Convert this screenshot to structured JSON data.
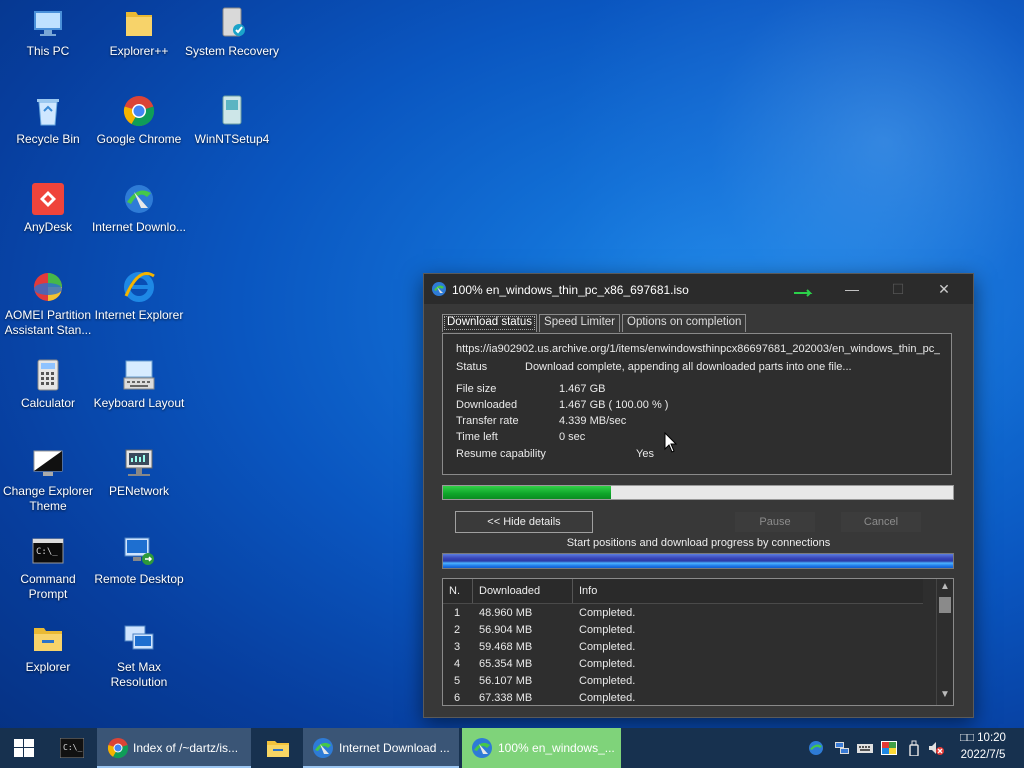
{
  "desktop": {
    "icons": [
      {
        "label": "This PC",
        "name": "this-pc-icon"
      },
      {
        "label": "Explorer++",
        "name": "explorer-plus-plus-icon"
      },
      {
        "label": "System Recovery",
        "name": "system-recovery-icon"
      },
      {
        "label": "Recycle Bin",
        "name": "recycle-bin-icon"
      },
      {
        "label": "Google Chrome",
        "name": "google-chrome-icon"
      },
      {
        "label": "WinNTSetup4",
        "name": "winntsetup-icon"
      },
      {
        "label": "AnyDesk",
        "name": "anydesk-icon"
      },
      {
        "label": "Internet Downlo...",
        "name": "internet-download-manager-icon"
      },
      {
        "label": "AOMEI Partition Assistant Stan...",
        "name": "aomei-partition-icon"
      },
      {
        "label": "Internet Explorer",
        "name": "internet-explorer-icon"
      },
      {
        "label": "Calculator",
        "name": "calculator-icon"
      },
      {
        "label": "Keyboard Layout",
        "name": "keyboard-layout-icon"
      },
      {
        "label": "Change Explorer Theme",
        "name": "change-explorer-theme-icon"
      },
      {
        "label": "PENetwork",
        "name": "penetwork-icon"
      },
      {
        "label": "Command Prompt",
        "name": "command-prompt-icon"
      },
      {
        "label": "Remote Desktop",
        "name": "remote-desktop-icon"
      },
      {
        "label": "Explorer",
        "name": "explorer-icon"
      },
      {
        "label": "Set Max Resolution",
        "name": "set-max-resolution-icon"
      }
    ]
  },
  "dialog": {
    "title": "100% en_windows_thin_pc_x86_697681.iso",
    "tabs": [
      "Download status",
      "Speed Limiter",
      "Options on completion"
    ],
    "url": "https://ia902902.us.archive.org/1/items/enwindowsthinpcx86697681_202003/en_windows_thin_pc_",
    "status_label": "Status",
    "status_value": "Download complete, appending all downloaded parts into one file...",
    "file_size_label": "File size",
    "file_size_value": "1.467  GB",
    "downloaded_label": "Downloaded",
    "downloaded_value": "1.467  GB  ( 100.00 % )",
    "transfer_rate_label": "Transfer rate",
    "transfer_rate_value": "4.339  MB/sec",
    "time_left_label": "Time left",
    "time_left_value": "0 sec",
    "resume_label": "Resume capability",
    "resume_value": "Yes",
    "progress_fraction": 0.33,
    "hide_details_label": "<< Hide details",
    "pause_label": "Pause",
    "cancel_label": "Cancel",
    "connections_label": "Start positions and download progress by connections",
    "table": {
      "headers": [
        "N.",
        "Downloaded",
        "Info"
      ],
      "rows": [
        {
          "n": "1",
          "downloaded": "48.960  MB",
          "info": "Completed."
        },
        {
          "n": "2",
          "downloaded": "56.904  MB",
          "info": "Completed."
        },
        {
          "n": "3",
          "downloaded": "59.468  MB",
          "info": "Completed."
        },
        {
          "n": "4",
          "downloaded": "65.354  MB",
          "info": "Completed."
        },
        {
          "n": "5",
          "downloaded": "56.107  MB",
          "info": "Completed."
        },
        {
          "n": "6",
          "downloaded": "67.338  MB",
          "info": "Completed."
        }
      ]
    }
  },
  "taskbar": {
    "apps": [
      {
        "label": "Index of /~dartz/is...",
        "name": "taskbar-chrome"
      },
      {
        "label": "Internet Download ...",
        "name": "taskbar-idm"
      },
      {
        "label": "100% en_windows_...",
        "name": "taskbar-download-progress"
      }
    ],
    "clock_time": "10:20",
    "clock_date": "2022/7/5",
    "ime_label": "□□"
  },
  "colors": {
    "accent_green": "#0ea52a",
    "taskbar_active": "#7fd37a",
    "taskbar_bg": "#17314f"
  }
}
